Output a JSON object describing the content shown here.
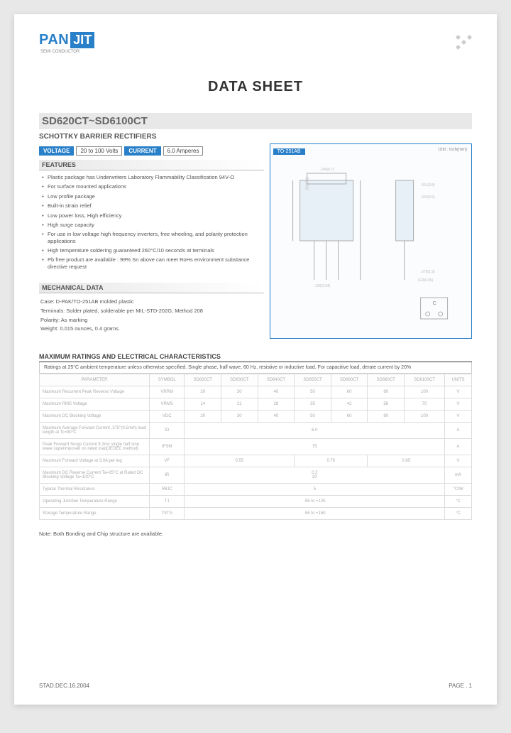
{
  "logo": {
    "part1": "PAN",
    "part2": "JIT",
    "subtitle": "SEMI CONDUCTOR"
  },
  "doc_title": "DATA  SHEET",
  "part_number": "SD620CT~SD6100CT",
  "product_type": "SCHOTTKY BARRIER RECTIFIERS",
  "chips": {
    "voltage_label": "VOLTAGE",
    "voltage_val": "20 to 100 Volts",
    "current_label": "CURRENT",
    "current_val": "6.0 Amperes"
  },
  "package": {
    "label": "TO-251AB",
    "unit": "Unit : inch(mm)"
  },
  "features_title": "FEATURES",
  "features": [
    "Plastic package has Underwriters Laboratory Flammability Classification 94V-O",
    "For surface mounted applications",
    "Low profile package",
    "Built-in strain relief",
    "Low power loss, High efficiency",
    "High surge capacity",
    "For use in low voltage high frequency inverters, free wheeling, and polarity protection applications",
    "High temperature soldering guaranteed:260°C/10 seconds at terminals",
    "Pb free product are available : 99% Sn above can meet RoHs environment substance directive request"
  ],
  "mechanical_title": "MECHANICAL DATA",
  "mechanical": {
    "case": "Case: D-PAK/TO-251AB molded plastic",
    "terminals": "Terminals: Solder plated, solderable per MIL-STD-202G, Method 208",
    "polarity": "Polarity: As marking",
    "weight": "Weight: 0.015 ounces, 0.4 grams."
  },
  "ratings_title": "MAXIMUM RATINGS AND ELECTRICAL CHARACTERISTICS",
  "ratings_note": "Ratings at 25°C ambient temperature unless otherwise specified. Single phase, half wave, 60 Hz, resistive or inductive load. For capacitive load, derate current by 20%",
  "table": {
    "headers": [
      "PARAMETER",
      "SYMBOL",
      "SD620CT",
      "SD630CT",
      "SD640CT",
      "SD650CT",
      "SD660CT",
      "SD680CT",
      "SD6100CT",
      "UNITS"
    ],
    "rows": [
      {
        "param": "Maximum Recurrent Peak Reverse Voltage",
        "sym": "VRRM",
        "vals": [
          "20",
          "30",
          "40",
          "50",
          "60",
          "80",
          "100"
        ],
        "unit": "V"
      },
      {
        "param": "Maximum RMS Voltage",
        "sym": "VRMS",
        "vals": [
          "14",
          "21",
          "28",
          "35",
          "42",
          "56",
          "70"
        ],
        "unit": "V"
      },
      {
        "param": "Maximum DC Blocking Voltage",
        "sym": "VDC",
        "vals": [
          "20",
          "30",
          "40",
          "50",
          "60",
          "80",
          "100"
        ],
        "unit": "V"
      },
      {
        "param": "Maximum Average Forward Current .375\"(9.5mm) lead length at Tc=90°C",
        "sym": "IO",
        "span": "6.0",
        "unit": "A"
      },
      {
        "param": "Peak Forward Surge Current 8.3ms single half sine wave superimposed on rated load(JEDEC method)",
        "sym": "IFSM",
        "span": "75",
        "unit": "A"
      },
      {
        "param": "Maximum Forward Voltage at 3.0A per leg",
        "sym": "VF",
        "group3": [
          "0.55",
          "0.70",
          "0.85"
        ],
        "unit": "V"
      },
      {
        "param": "Maximum DC Reverse Current Ta=25°C\nat Rated DC Blocking Voltage Ta=100°C",
        "sym": "IR",
        "stack": [
          "0.2",
          "20"
        ],
        "unit": "mA"
      },
      {
        "param": "Typical Thermal Resistance",
        "sym": "RθJC",
        "span": "5",
        "unit": "°C/W"
      },
      {
        "param": "Operating Junction Temperature Range",
        "sym": "TJ",
        "span": "-55 to +125",
        "unit": "°C"
      },
      {
        "param": "Storage Temperature Range",
        "sym": "TSTG",
        "span": "-55 to +150",
        "unit": "°C"
      }
    ]
  },
  "foot_note": "Note: Both Bonding and Chip structure are available.",
  "footer": {
    "left": "STAD.DEC.16.2004",
    "right": "PAGE . 1"
  }
}
